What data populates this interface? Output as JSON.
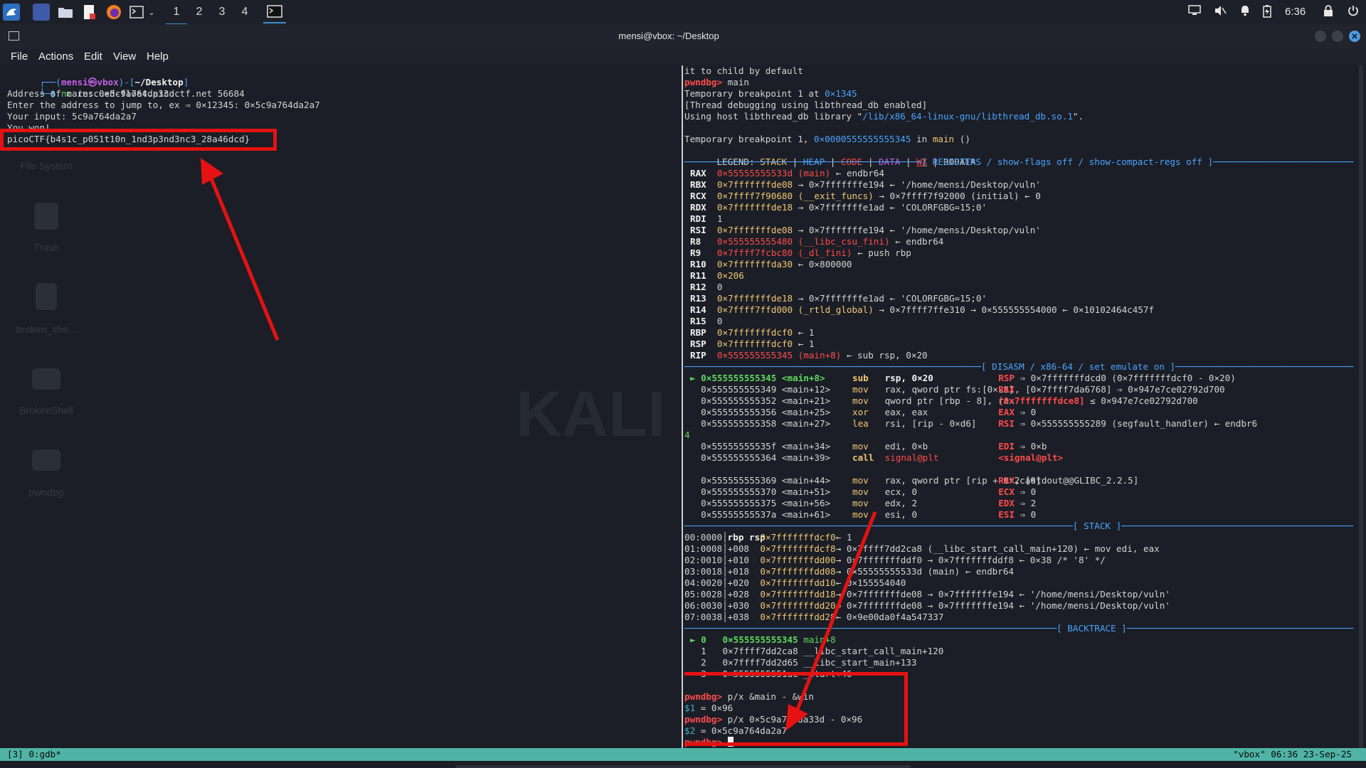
{
  "taskbar": {
    "workspaces": [
      "1",
      "2",
      "3",
      "4"
    ],
    "active_workspace": "1",
    "clock": "6:36",
    "icons": [
      "kali-menu-icon",
      "desktop-icon",
      "files-icon",
      "text-editor-icon",
      "firefox-icon",
      "terminal-icon",
      "dropdown-icon"
    ],
    "tray_icons": [
      "display-icon",
      "mute-icon",
      "bell-icon",
      "battery-icon",
      "lock-icon",
      "power-icon"
    ]
  },
  "window": {
    "title": "mensi@vbox: ~/Desktop"
  },
  "menubar": [
    "File",
    "Actions",
    "Edit",
    "View",
    "Help"
  ],
  "desktop": {
    "items": [
      "File System",
      "Trash",
      "broken_she...",
      "BrokenShell",
      "pwndbg"
    ],
    "bg_text": "KALI"
  },
  "left_terminal": {
    "prompt_user": "mensi",
    "prompt_host": "vbox",
    "prompt_dir": "~/Desktop",
    "command_nc": "nc",
    "command_args": "rescued-float.picoctf.net 56684",
    "lines": [
      "Address of main: 0×5c9a764da33d",
      "Enter the address to jump to, ex ⇒ 0×12345: 0×5c9a764da2a7",
      "Your input: 5c9a764da2a7",
      "You won!"
    ],
    "flag": "picoCTF{b4s1c_p051t10n_1nd3p3nd3nc3_28a46dcd}"
  },
  "right_terminal": {
    "header_lines": [
      "it to child by default",
      "Temporary breakpoint 1 at ",
      "[Thread debugging using libthread_db enabled]",
      "Using host libthread_db library \"",
      "Temporary breakpoint 1, "
    ],
    "pwndbg_prompt": "pwndbg>",
    "cmd_main": "main",
    "bp_addr": "0×1345",
    "lib_path": "/lib/x86_64-linux-gnu/libthread_db.so.1",
    "lib_tail": "\".",
    "bp_full_addr": "0×0000555555555345",
    "bp_in": " in ",
    "bp_fn": "main",
    "bp_paren": " ()",
    "legend_label": "LEGEND: ",
    "legend": [
      "STACK",
      "HEAP",
      "CODE",
      "DATA",
      "WX",
      "RODATA"
    ],
    "sep_registers": "[ REGISTERS / show-flags off / show-compact-regs off ]",
    "registers": [
      {
        "name": "RAX",
        "val": "0×55555555533d (main)",
        "rest": " ← endbr64"
      },
      {
        "name": "RBX",
        "val": "0×7fffffffde08",
        "rest": " → 0×7fffffffe194 ← '/home/mensi/Desktop/vuln'"
      },
      {
        "name": "RCX",
        "val": "0×7ffff7f90680 (__exit_funcs)",
        "rest": " → 0×7ffff7f92000 (initial) ← 0"
      },
      {
        "name": "RDX",
        "val": "0×7fffffffde18",
        "rest": " → 0×7fffffffe1ad ← 'COLORFGBG=15;0'"
      },
      {
        "name": "RDI",
        "val": "1",
        "rest": ""
      },
      {
        "name": "RSI",
        "val": "0×7fffffffde08",
        "rest": " → 0×7fffffffe194 ← '/home/mensi/Desktop/vuln'"
      },
      {
        "name": "R8",
        "val": "0×555555555480 (__libc_csu_fini)",
        "rest": " ← endbr64"
      },
      {
        "name": "R9",
        "val": "0×7ffff7fcbc80 (_dl_fini)",
        "rest": " ← push rbp"
      },
      {
        "name": "R10",
        "val": "0×7fffffffda30",
        "rest": " ← 0×800000"
      },
      {
        "name": "R11",
        "val": "0×206",
        "rest": ""
      },
      {
        "name": "R12",
        "val": "0",
        "rest": ""
      },
      {
        "name": "R13",
        "val": "0×7fffffffde18",
        "rest": " → 0×7fffffffe1ad ← 'COLORFGBG=15;0'"
      },
      {
        "name": "R14",
        "val": "0×7ffff7ffd000 (_rtld_global)",
        "rest": " → 0×7ffff7ffe310 → 0×555555554000 ← 0×10102464c457f"
      },
      {
        "name": "R15",
        "val": "0",
        "rest": ""
      },
      {
        "name": "RBP",
        "val": "0×7fffffffdcf0",
        "rest": " ← 1"
      },
      {
        "name": "RSP",
        "val": "0×7fffffffdcf0",
        "rest": " ← 1"
      },
      {
        "name": "RIP",
        "val": "0×555555555345 (main+8)",
        "rest": " ← sub rsp, 0×20"
      }
    ],
    "sep_disasm": "[ DISASM / x86-64 / set emulate on ]",
    "disasm": [
      {
        "marker": "►",
        "addr": "0×555555555345 <main+8>",
        "op": "sub",
        "args": "rsp, 0×20",
        "cmt": "RSP ⇒ 0×7fffffffdcd0 (0×7fffffffdcf0 - 0×20)"
      },
      {
        "marker": "",
        "addr": "0×555555555349 <main+12>",
        "op": "mov",
        "args": "rax, qword ptr fs:[0×28]",
        "cmt": "RAX, [0×7ffff7da6768] ⇒ 0×947e7ce02792d700"
      },
      {
        "marker": "",
        "addr": "0×555555555352 <main+21>",
        "op": "mov",
        "args": "qword ptr [rbp - 8], rax",
        "cmt": "[0×7fffffffdce8] ≤ 0×947e7ce02792d700"
      },
      {
        "marker": "",
        "addr": "0×555555555356 <main+25>",
        "op": "xor",
        "args": "eax, eax",
        "cmt": "EAX ⇒ 0"
      },
      {
        "marker": "",
        "addr": "0×555555555358 <main+27>",
        "op": "lea",
        "args": "rsi, [rip - 0×d6]",
        "cmt": "RSI ⇒ 0×555555555289 (segfault_handler) ← endbr6"
      },
      {
        "marker": "",
        "addr": "4",
        "op": "",
        "args": "",
        "cmt": ""
      },
      {
        "marker": "",
        "addr": "0×55555555535f <main+34>",
        "op": "mov",
        "args": "edi, 0×b",
        "cmt": "EDI ⇒ 0×b"
      },
      {
        "marker": "",
        "addr": "0×555555555364 <main+39>",
        "op": "call",
        "args": "signal@plt",
        "cmt": "<signal@plt>"
      },
      {
        "marker": "",
        "addr": "",
        "op": "",
        "args": "",
        "cmt": ""
      },
      {
        "marker": "",
        "addr": "0×555555555369 <main+44>",
        "op": "mov",
        "args": "rax, qword ptr [rip + 0×2ca0]",
        "cmt": "RAX, [stdout@@GLIBC_2.2.5]"
      },
      {
        "marker": "",
        "addr": "0×555555555370 <main+51>",
        "op": "mov",
        "args": "ecx, 0",
        "cmt": "ECX ⇒ 0"
      },
      {
        "marker": "",
        "addr": "0×555555555375 <main+56>",
        "op": "mov",
        "args": "edx, 2",
        "cmt": "EDX ⇒ 2"
      },
      {
        "marker": "",
        "addr": "0×55555555537a <main+61>",
        "op": "mov",
        "args": "esi, 0",
        "cmt": "ESI ⇒ 0"
      }
    ],
    "sep_stack": "[ STACK ]",
    "stack": [
      {
        "idx": "00:0000",
        "off": "",
        "reg": "rbp rsp",
        "addr": "0×7fffffffdcf0",
        "rest": " ← 1"
      },
      {
        "idx": "01:0008",
        "off": "+008",
        "reg": "",
        "addr": "0×7fffffffdcf8",
        "rest": " → 0×7ffff7dd2ca8 (__libc_start_call_main+120) ← mov edi, eax"
      },
      {
        "idx": "02:0010",
        "off": "+010",
        "reg": "",
        "addr": "0×7fffffffdd00",
        "rest": " → 0×7fffffffddf0 → 0×7fffffffddf8 ← 0×38 /* '8' */"
      },
      {
        "idx": "03:0018",
        "off": "+018",
        "reg": "",
        "addr": "0×7fffffffdd08",
        "rest": " → 0×55555555533d (main) ← endbr64"
      },
      {
        "idx": "04:0020",
        "off": "+020",
        "reg": "",
        "addr": "0×7fffffffdd10",
        "rest": " ← 0×155554040"
      },
      {
        "idx": "05:0028",
        "off": "+028",
        "reg": "",
        "addr": "0×7fffffffdd18",
        "rest": " → 0×7fffffffde08 → 0×7fffffffe194 ← '/home/mensi/Desktop/vuln'"
      },
      {
        "idx": "06:0030",
        "off": "+030",
        "reg": "",
        "addr": "0×7fffffffdd20",
        "rest": " → 0×7fffffffde08 → 0×7fffffffe194 ← '/home/mensi/Desktop/vuln'"
      },
      {
        "idx": "07:0038",
        "off": "+038",
        "reg": "",
        "addr": "0×7fffffffdd28",
        "rest": " ← 0×9e00da0f4a547337"
      }
    ],
    "sep_backtrace": "[ BACKTRACE ]",
    "backtrace": [
      {
        "marker": "►",
        "num": "0",
        "addr": "0×555555555345",
        "fn": "main+8"
      },
      {
        "marker": "",
        "num": "1",
        "addr": "0×7ffff7dd2ca8",
        "fn": "__libc_start_call_main+120"
      },
      {
        "marker": "",
        "num": "2",
        "addr": "0×7ffff7dd2d65",
        "fn": "__libc_start_main+133"
      },
      {
        "marker": "",
        "num": "3",
        "addr": "0×5555555551ae",
        "fn": "_start+46"
      }
    ],
    "commands": [
      {
        "prompt": "pwndbg>",
        "cmd": " p/x &main - &win"
      },
      {
        "result_var": "$1",
        "result_val": " = 0×96"
      },
      {
        "prompt": "pwndbg>",
        "cmd": " p/x 0×5c9a764da33d - 0×96"
      },
      {
        "result_var": "$2",
        "result_val": " = 0×5c9a764da2a7"
      },
      {
        "prompt": "pwndbg>",
        "cmd": " "
      }
    ]
  },
  "statusbar": {
    "left": "[3] 0:gdb*",
    "right": "\"vbox\" 06:36 23-Sep-25"
  },
  "colors": {
    "annotation_red": "#e41212",
    "status_teal": "#4fb3a5",
    "prompt_red": "#ff4b4b",
    "address_purple": "#c35ee6"
  }
}
